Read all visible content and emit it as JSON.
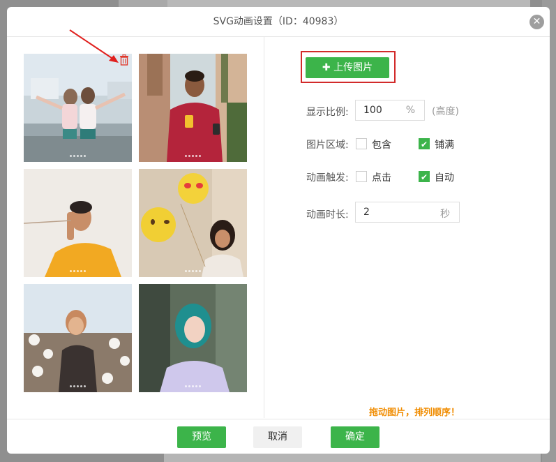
{
  "dialog": {
    "title": "SVG动画设置（ID：40983）",
    "close_label": "✕"
  },
  "upload": {
    "label": "上传图片",
    "plus": "✚"
  },
  "form": {
    "ratio": {
      "label": "显示比例:",
      "value": "100",
      "unit": "%",
      "hint": "(高度)"
    },
    "area": {
      "label": "图片区域:",
      "option1": "包含",
      "option2": "铺满",
      "option1_checked": false,
      "option2_checked": true
    },
    "trigger": {
      "label": "动画触发:",
      "option1": "点击",
      "option2": "自动",
      "option1_checked": false,
      "option2_checked": true
    },
    "duration": {
      "label": "动画时长:",
      "value": "2",
      "unit": "秒"
    }
  },
  "tip": "拖动图片，排列顺序！",
  "footer": {
    "preview": "预览",
    "cancel": "取消",
    "confirm": "确定"
  },
  "images": [
    {
      "name": "two-girls-photo"
    },
    {
      "name": "man-with-drink-photo"
    },
    {
      "name": "man-yellow-shirt-photo"
    },
    {
      "name": "woman-with-balloons-photo"
    },
    {
      "name": "woman-cotton-field-photo"
    },
    {
      "name": "woman-teal-hair-photo"
    }
  ],
  "colors": {
    "accent": "#3cb44a",
    "highlight": "#d22a2a",
    "tip": "#f08c00"
  }
}
